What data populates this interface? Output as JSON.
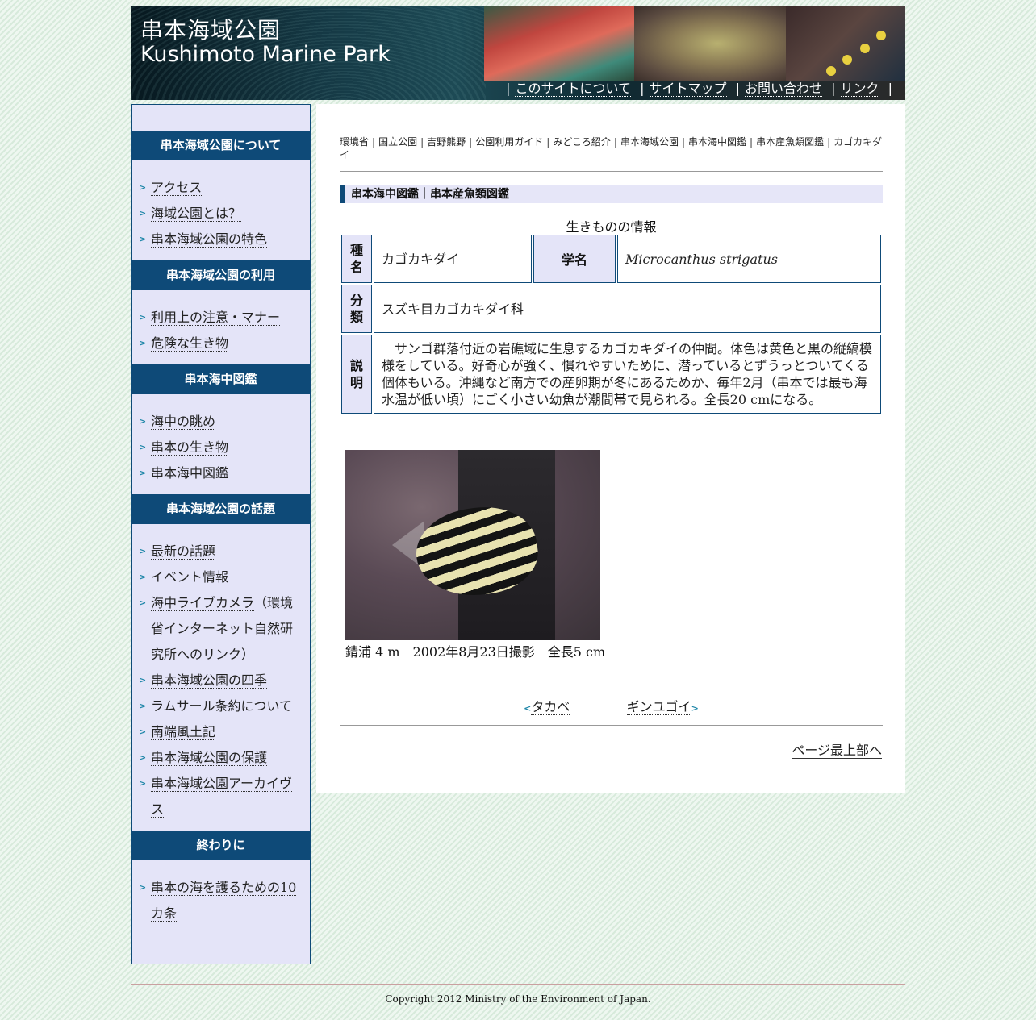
{
  "header": {
    "title_ja": "串本海域公園",
    "title_en": "Kushimoto Marine Park",
    "nav": [
      "このサイトについて",
      "サイトマップ",
      "お問い合わせ",
      "リンク"
    ]
  },
  "sidebar": {
    "sections": [
      {
        "title": "串本海域公園について",
        "items": [
          "アクセス",
          "海域公園とは？",
          "串本海域公園の特色"
        ]
      },
      {
        "title": "串本海域公園の利用",
        "items": [
          "利用上の注意・マナー",
          "危険な生き物"
        ]
      },
      {
        "title": "串本海中図鑑",
        "items": [
          "海中の眺め",
          "串本の生き物",
          "串本海中図鑑"
        ]
      },
      {
        "title": "串本海域公園の話題",
        "items": [
          "最新の話題",
          "イベント情報",
          "海中ライブカメラ",
          "串本海域公園の四季",
          "ラムサール条約について",
          "南端風土記",
          "串本海域公園の保護",
          "串本海域公園アーカイヴス"
        ],
        "livecam_note": "（環境省インターネット自然研究所へのリンク）"
      },
      {
        "title": "終わりに",
        "items": [
          "串本の海を護るための10カ条"
        ]
      }
    ]
  },
  "breadcrumb": [
    "環境省",
    "国立公園",
    "吉野熊野",
    "公園利用ガイド",
    "みどころ紹介",
    "串本海域公園",
    "串本海中図鑑",
    "串本産魚類図鑑",
    "カゴカキダイ"
  ],
  "section_title": "串本海中図鑑｜串本産魚類図鑑",
  "info": {
    "caption": "生きものの情報",
    "name_label": "種名",
    "name_value": "カゴカキダイ",
    "sci_label": "学名",
    "sci_value": "Microcanthus strigatus",
    "class_label": "分類",
    "class_value": "スズキ目カゴカキダイ科",
    "desc_label": "説明",
    "desc_value": "サンゴ群落付近の岩礁域に生息するカゴカキダイの仲間。体色は黄色と黒の縦縞模様をしている。好奇心が強く、慣れやすいために、潜っているとずうっとついてくる個体もいる。沖縄など南方での産卵期が冬にあるためか、毎年2月（串本では最も海水温が低い頃）にごく小さい幼魚が潮間帯で見られる。全長20 cmになる。"
  },
  "photo_caption": "錆浦 4 m　2002年8月23日撮影　全長5 cm",
  "pager": {
    "prev": "タカベ",
    "next": "ギンユゴイ"
  },
  "to_top": "ページ最上部へ",
  "copyright": "Copyright 2012 Ministry of the Environment of Japan."
}
